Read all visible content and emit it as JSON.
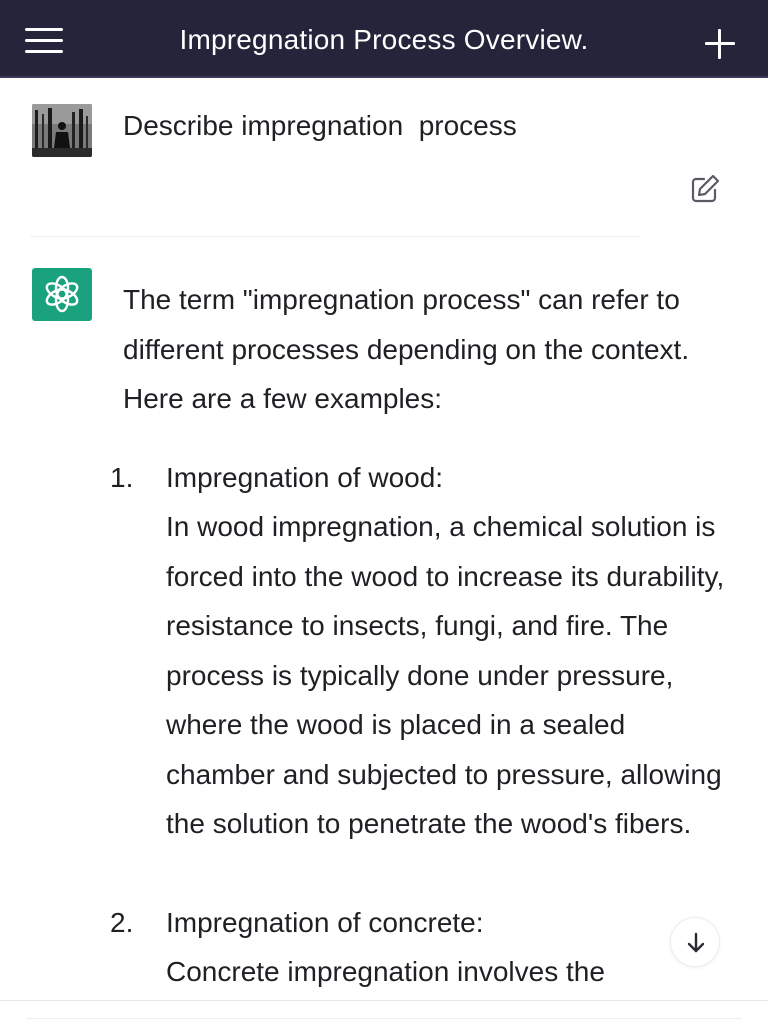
{
  "header": {
    "title": "Impregnation Process Overview.",
    "menu_icon": "hamburger-menu-icon",
    "new_chat_icon": "plus-icon"
  },
  "conversation": {
    "user_message": "Describe impregnation  process",
    "edit_icon": "edit-icon",
    "assistant_icon": "openai-logo-icon",
    "assistant_intro": "The term \"impregnation process\" can refer to different processes depending on the context. Here are a few examples:",
    "list_items": [
      {
        "number": "1.",
        "title": "Impregnation of wood:",
        "body": "In wood impregnation, a chemical solution is forced into the wood to increase its durability, resistance to insects, fungi, and fire. The process is typically done under pressure, where the wood is placed in a sealed chamber and subjected to pressure, allowing the solution to penetrate the wood's fibers."
      },
      {
        "number": "2.",
        "title": "Impregnation of concrete:",
        "body": "Concrete impregnation involves the"
      }
    ]
  },
  "controls": {
    "scroll_down_icon": "arrow-down-icon"
  },
  "colors": {
    "header_bg": "#24243a",
    "assistant_avatar_bg": "#1aa27e",
    "text": "#1f1f24"
  }
}
